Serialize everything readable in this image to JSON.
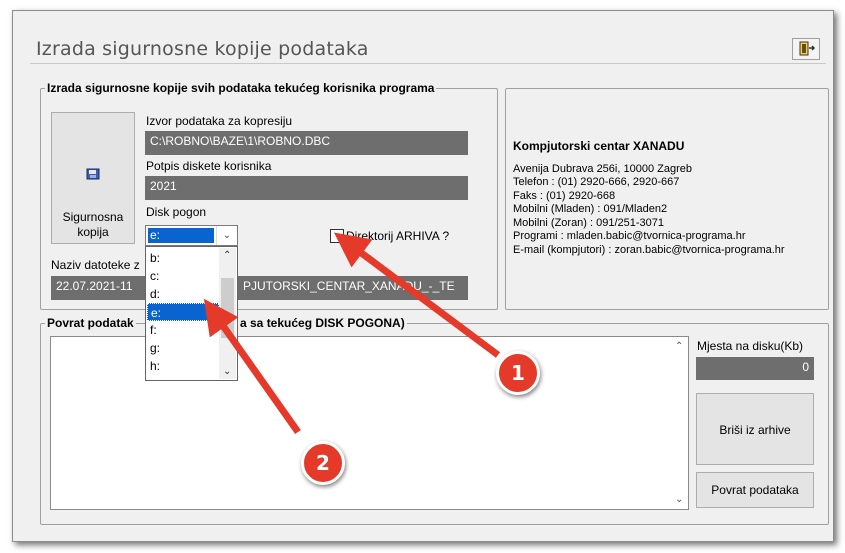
{
  "window": {
    "title": "Izrada sigurnosne kopije podataka"
  },
  "backup_group": {
    "legend": "Izrada sigurnosne kopije svih podataka tekućeg korisnika programa",
    "backup_button_label_1": "Sigurnosna",
    "backup_button_label_2": "kopija",
    "source_label": "Izvor podataka za kopresiju",
    "source_value": "C:\\ROBNO\\BAZE\\1\\ROBNO.DBC",
    "signature_label": "Potpis diskete korisnika",
    "signature_value": "2021",
    "drive_label": "Disk pogon",
    "drive_selected": "e:",
    "drive_options": [
      "b:",
      "c:",
      "d:",
      "e:",
      "f:",
      "g:",
      "h:"
    ],
    "archive_checkbox_label": "Direktorij ARHIVA ?",
    "filename_label": "Naziv datoteke z",
    "filename_value_left": "22.07.2021-11",
    "filename_value_right": "PJUTORSKI_CENTAR_XANADU_-_TE"
  },
  "contact": {
    "company": "Kompjutorski centar XANADU",
    "lines": [
      "Avenija Dubrava 256i, 10000 Zagreb",
      "Telefon : (01) 2920-666, 2920-667",
      "Faks : (01) 2920-668",
      "Mobilni (Mladen) : 091/Mladen2",
      "Mobilni (Zoran) : 091/251-3071",
      "Programi : mladen.babic@tvornica-programa.hr",
      "E-mail (kompjutori) : zoran.babic@tvornica-programa.hr"
    ]
  },
  "restore_group": {
    "legend_left": "Povrat podatak",
    "legend_right": "a sa tekućeg DISK POGONA)",
    "free_space_label": "Mjesta na disku(Kb)",
    "free_space_value": "0",
    "delete_button": "Briši iz arhive",
    "restore_button": "Povrat podataka"
  },
  "callouts": {
    "first": "1",
    "second": "2"
  },
  "colors": {
    "accent": "#0a64d0",
    "callout": "#e53a2a",
    "field_bg": "#6e6e6e"
  }
}
